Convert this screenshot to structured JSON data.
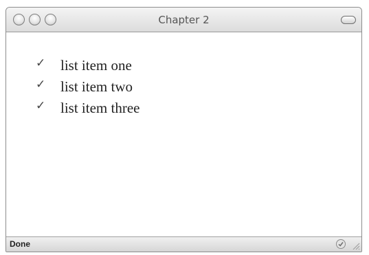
{
  "window": {
    "title": "Chapter 2"
  },
  "content": {
    "list_items": [
      {
        "marker_icon": "checkmark-icon",
        "marker": "✓",
        "label": "list item one"
      },
      {
        "marker_icon": "checkmark-icon",
        "marker": "✓",
        "label": "list item two"
      },
      {
        "marker_icon": "checkmark-icon",
        "marker": "✓",
        "label": "list item three"
      }
    ]
  },
  "statusbar": {
    "status_text": "Done",
    "security_icon": "page-load-status-icon"
  },
  "colors": {
    "titlebar_top": "#f4f4f4",
    "titlebar_bottom": "#dcdcdc",
    "page_background": "#ffffff",
    "text": "#222222"
  }
}
